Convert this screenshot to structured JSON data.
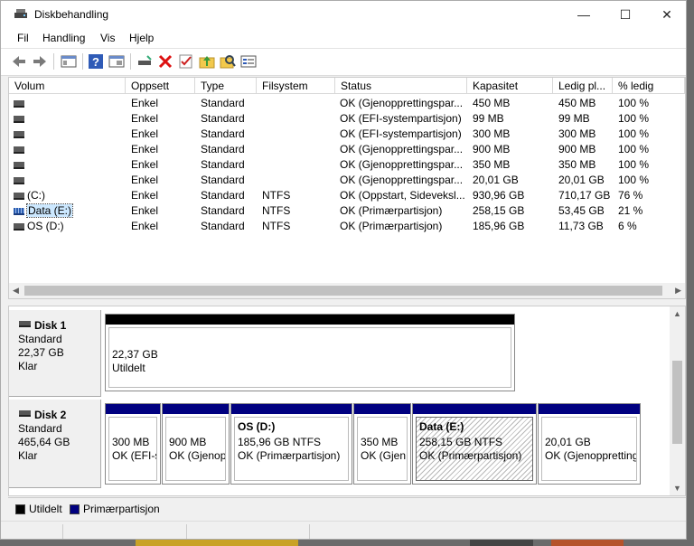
{
  "window": {
    "title": "Diskbehandling",
    "min_symbol": "—",
    "max_symbol": "☐",
    "close_symbol": "✕"
  },
  "menu": [
    {
      "label": "Fil"
    },
    {
      "label": "Handling"
    },
    {
      "label": "Vis"
    },
    {
      "label": "Hjelp"
    }
  ],
  "toolbar": {
    "icons": [
      "back-icon",
      "forward-icon",
      "console-tree-icon",
      "help-icon",
      "properties-icon",
      "connect-drive-icon",
      "delete-icon",
      "check-icon",
      "folder-up-icon",
      "search-icon",
      "list-icon"
    ]
  },
  "volume_list": {
    "columns": [
      "Volum",
      "Oppsett",
      "Type",
      "Filsystem",
      "Status",
      "Kapasitet",
      "Ledig pl...",
      "% ledig"
    ],
    "rows": [
      {
        "name": "",
        "layout": "Enkel",
        "type": "Standard",
        "fs": "",
        "status": "OK (Gjenopprettingspar...",
        "capacity": "450 MB",
        "free": "450 MB",
        "pct": "100 %"
      },
      {
        "name": "",
        "layout": "Enkel",
        "type": "Standard",
        "fs": "",
        "status": "OK (EFI-systempartisjon)",
        "capacity": "99 MB",
        "free": "99 MB",
        "pct": "100 %"
      },
      {
        "name": "",
        "layout": "Enkel",
        "type": "Standard",
        "fs": "",
        "status": "OK (EFI-systempartisjon)",
        "capacity": "300 MB",
        "free": "300 MB",
        "pct": "100 %"
      },
      {
        "name": "",
        "layout": "Enkel",
        "type": "Standard",
        "fs": "",
        "status": "OK (Gjenopprettingspar...",
        "capacity": "900 MB",
        "free": "900 MB",
        "pct": "100 %"
      },
      {
        "name": "",
        "layout": "Enkel",
        "type": "Standard",
        "fs": "",
        "status": "OK (Gjenopprettingspar...",
        "capacity": "350 MB",
        "free": "350 MB",
        "pct": "100 %"
      },
      {
        "name": "",
        "layout": "Enkel",
        "type": "Standard",
        "fs": "",
        "status": "OK (Gjenopprettingspar...",
        "capacity": "20,01 GB",
        "free": "20,01 GB",
        "pct": "100 %"
      },
      {
        "name": " (C:)",
        "layout": "Enkel",
        "type": "Standard",
        "fs": "NTFS",
        "status": "OK (Oppstart, Sideveksl...",
        "capacity": "930,96 GB",
        "free": "710,17 GB",
        "pct": "76 %"
      },
      {
        "name": "Data (E:)",
        "layout": "Enkel",
        "type": "Standard",
        "fs": "NTFS",
        "status": "OK (Primærpartisjon)",
        "capacity": "258,15 GB",
        "free": "53,45 GB",
        "pct": "21 %",
        "selected": true
      },
      {
        "name": "OS (D:)",
        "layout": "Enkel",
        "type": "Standard",
        "fs": "NTFS",
        "status": "OK (Primærpartisjon)",
        "capacity": "185,96 GB",
        "free": "11,73 GB",
        "pct": "6 %"
      }
    ]
  },
  "disks": [
    {
      "name": "Disk 1",
      "type": "Standard",
      "size": "22,37 GB",
      "state": "Klar",
      "partitions": [
        {
          "title": "",
          "line1": "22,37 GB",
          "line2": "Utildelt",
          "kind": "unallocated"
        }
      ]
    },
    {
      "name": "Disk 2",
      "type": "Standard",
      "size": "465,64 GB",
      "state": "Klar",
      "partitions": [
        {
          "title": "",
          "line1": "300 MB",
          "line2": "OK (EFI-s",
          "kind": "primary"
        },
        {
          "title": "",
          "line1": "900 MB",
          "line2": "OK (Gjenop",
          "kind": "primary"
        },
        {
          "title": "OS  (D:)",
          "line1": "185,96 GB NTFS",
          "line2": "OK (Primærpartisjon)",
          "kind": "primary"
        },
        {
          "title": "",
          "line1": "350 MB",
          "line2": "OK (Gjen",
          "kind": "primary"
        },
        {
          "title": "Data  (E:)",
          "line1": "258,15 GB NTFS",
          "line2": "OK (Primærpartisjon)",
          "kind": "primary",
          "selected": true
        },
        {
          "title": "",
          "line1": "20,01 GB",
          "line2": "OK (Gjenoppretting",
          "kind": "primary"
        }
      ]
    }
  ],
  "legend": [
    {
      "label": "Utildelt",
      "color": "#000000"
    },
    {
      "label": "Primærpartisjon",
      "color": "#000080"
    }
  ],
  "colors": {
    "unallocated": "#000000",
    "primary": "#000080",
    "selection": "#cce8ff"
  }
}
